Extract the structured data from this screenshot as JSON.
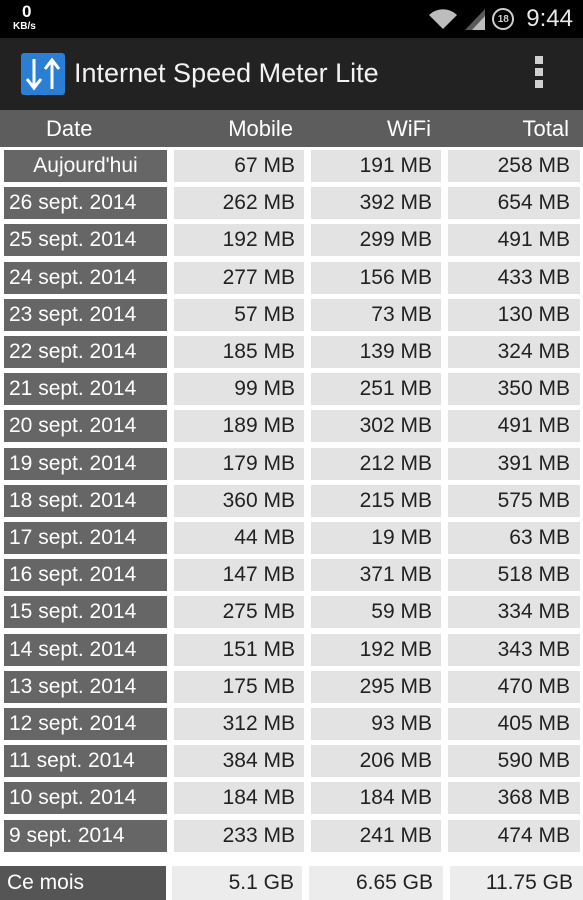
{
  "statusbar": {
    "speed_value": "0",
    "speed_unit": "KB/s",
    "notif_badge": "18",
    "clock": "9:44"
  },
  "actionbar": {
    "title": "Internet Speed Meter Lite",
    "app_icon": "up-down-arrows-icon",
    "menu_icon": "overflow-menu-icon"
  },
  "columns": {
    "date": "Date",
    "mobile": "Mobile",
    "wifi": "WiFi",
    "total": "Total"
  },
  "rows": [
    {
      "date": "Aujourd'hui",
      "mobile": "67 MB",
      "wifi": "191 MB",
      "total": "258 MB"
    },
    {
      "date": "26 sept. 2014",
      "mobile": "262 MB",
      "wifi": "392 MB",
      "total": "654 MB"
    },
    {
      "date": "25 sept. 2014",
      "mobile": "192 MB",
      "wifi": "299 MB",
      "total": "491 MB"
    },
    {
      "date": "24 sept. 2014",
      "mobile": "277 MB",
      "wifi": "156 MB",
      "total": "433 MB"
    },
    {
      "date": "23 sept. 2014",
      "mobile": "57 MB",
      "wifi": "73 MB",
      "total": "130 MB"
    },
    {
      "date": "22 sept. 2014",
      "mobile": "185 MB",
      "wifi": "139 MB",
      "total": "324 MB"
    },
    {
      "date": "21 sept. 2014",
      "mobile": "99 MB",
      "wifi": "251 MB",
      "total": "350 MB"
    },
    {
      "date": "20 sept. 2014",
      "mobile": "189 MB",
      "wifi": "302 MB",
      "total": "491 MB"
    },
    {
      "date": "19 sept. 2014",
      "mobile": "179 MB",
      "wifi": "212 MB",
      "total": "391 MB"
    },
    {
      "date": "18 sept. 2014",
      "mobile": "360 MB",
      "wifi": "215 MB",
      "total": "575 MB"
    },
    {
      "date": "17 sept. 2014",
      "mobile": "44 MB",
      "wifi": "19 MB",
      "total": "63 MB"
    },
    {
      "date": "16 sept. 2014",
      "mobile": "147 MB",
      "wifi": "371 MB",
      "total": "518 MB"
    },
    {
      "date": "15 sept. 2014",
      "mobile": "275 MB",
      "wifi": "59 MB",
      "total": "334 MB"
    },
    {
      "date": "14 sept. 2014",
      "mobile": "151 MB",
      "wifi": "192 MB",
      "total": "343 MB"
    },
    {
      "date": "13 sept. 2014",
      "mobile": "175 MB",
      "wifi": "295 MB",
      "total": "470 MB"
    },
    {
      "date": "12 sept. 2014",
      "mobile": "312 MB",
      "wifi": "93 MB",
      "total": "405 MB"
    },
    {
      "date": "11 sept. 2014",
      "mobile": "384 MB",
      "wifi": "206 MB",
      "total": "590 MB"
    },
    {
      "date": "10 sept. 2014",
      "mobile": "184 MB",
      "wifi": "184 MB",
      "total": "368 MB"
    },
    {
      "date": "9 sept. 2014",
      "mobile": "233 MB",
      "wifi": "241 MB",
      "total": "474 MB"
    }
  ],
  "footer": {
    "label": "Ce mois",
    "mobile": "5.1 GB",
    "wifi": "6.65 GB",
    "total": "11.75 GB"
  },
  "colors": {
    "date_cell": "#666666",
    "value_cell": "#e3e3e3",
    "header": "#5d5d5d",
    "actionbar": "#222222",
    "icon_blue": "#2a7fd4"
  }
}
